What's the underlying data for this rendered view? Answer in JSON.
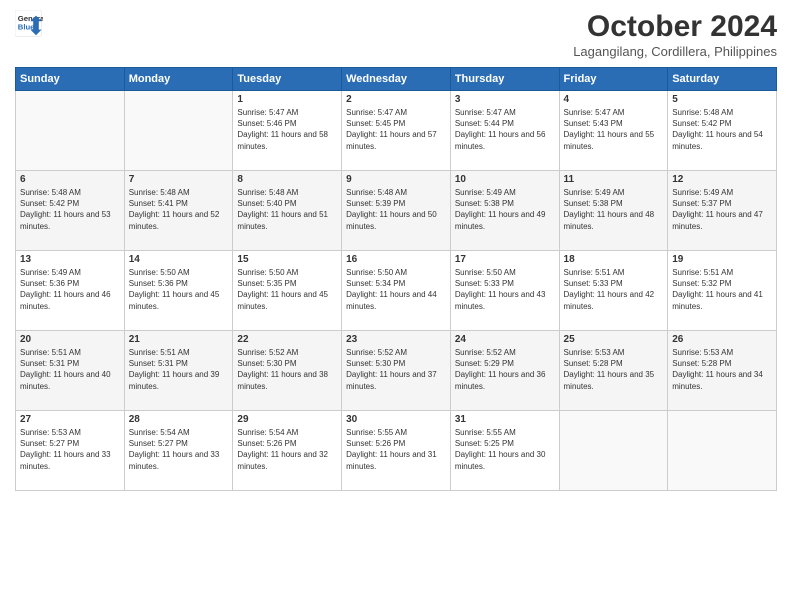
{
  "header": {
    "logo_line1": "General",
    "logo_line2": "Blue",
    "title": "October 2024",
    "subtitle": "Lagangilang, Cordillera, Philippines"
  },
  "days_of_week": [
    "Sunday",
    "Monday",
    "Tuesday",
    "Wednesday",
    "Thursday",
    "Friday",
    "Saturday"
  ],
  "weeks": [
    [
      {
        "day": "",
        "info": ""
      },
      {
        "day": "",
        "info": ""
      },
      {
        "day": "1",
        "info": "Sunrise: 5:47 AM\nSunset: 5:46 PM\nDaylight: 11 hours and 58 minutes."
      },
      {
        "day": "2",
        "info": "Sunrise: 5:47 AM\nSunset: 5:45 PM\nDaylight: 11 hours and 57 minutes."
      },
      {
        "day": "3",
        "info": "Sunrise: 5:47 AM\nSunset: 5:44 PM\nDaylight: 11 hours and 56 minutes."
      },
      {
        "day": "4",
        "info": "Sunrise: 5:47 AM\nSunset: 5:43 PM\nDaylight: 11 hours and 55 minutes."
      },
      {
        "day": "5",
        "info": "Sunrise: 5:48 AM\nSunset: 5:42 PM\nDaylight: 11 hours and 54 minutes."
      }
    ],
    [
      {
        "day": "6",
        "info": "Sunrise: 5:48 AM\nSunset: 5:42 PM\nDaylight: 11 hours and 53 minutes."
      },
      {
        "day": "7",
        "info": "Sunrise: 5:48 AM\nSunset: 5:41 PM\nDaylight: 11 hours and 52 minutes."
      },
      {
        "day": "8",
        "info": "Sunrise: 5:48 AM\nSunset: 5:40 PM\nDaylight: 11 hours and 51 minutes."
      },
      {
        "day": "9",
        "info": "Sunrise: 5:48 AM\nSunset: 5:39 PM\nDaylight: 11 hours and 50 minutes."
      },
      {
        "day": "10",
        "info": "Sunrise: 5:49 AM\nSunset: 5:38 PM\nDaylight: 11 hours and 49 minutes."
      },
      {
        "day": "11",
        "info": "Sunrise: 5:49 AM\nSunset: 5:38 PM\nDaylight: 11 hours and 48 minutes."
      },
      {
        "day": "12",
        "info": "Sunrise: 5:49 AM\nSunset: 5:37 PM\nDaylight: 11 hours and 47 minutes."
      }
    ],
    [
      {
        "day": "13",
        "info": "Sunrise: 5:49 AM\nSunset: 5:36 PM\nDaylight: 11 hours and 46 minutes."
      },
      {
        "day": "14",
        "info": "Sunrise: 5:50 AM\nSunset: 5:36 PM\nDaylight: 11 hours and 45 minutes."
      },
      {
        "day": "15",
        "info": "Sunrise: 5:50 AM\nSunset: 5:35 PM\nDaylight: 11 hours and 45 minutes."
      },
      {
        "day": "16",
        "info": "Sunrise: 5:50 AM\nSunset: 5:34 PM\nDaylight: 11 hours and 44 minutes."
      },
      {
        "day": "17",
        "info": "Sunrise: 5:50 AM\nSunset: 5:33 PM\nDaylight: 11 hours and 43 minutes."
      },
      {
        "day": "18",
        "info": "Sunrise: 5:51 AM\nSunset: 5:33 PM\nDaylight: 11 hours and 42 minutes."
      },
      {
        "day": "19",
        "info": "Sunrise: 5:51 AM\nSunset: 5:32 PM\nDaylight: 11 hours and 41 minutes."
      }
    ],
    [
      {
        "day": "20",
        "info": "Sunrise: 5:51 AM\nSunset: 5:31 PM\nDaylight: 11 hours and 40 minutes."
      },
      {
        "day": "21",
        "info": "Sunrise: 5:51 AM\nSunset: 5:31 PM\nDaylight: 11 hours and 39 minutes."
      },
      {
        "day": "22",
        "info": "Sunrise: 5:52 AM\nSunset: 5:30 PM\nDaylight: 11 hours and 38 minutes."
      },
      {
        "day": "23",
        "info": "Sunrise: 5:52 AM\nSunset: 5:30 PM\nDaylight: 11 hours and 37 minutes."
      },
      {
        "day": "24",
        "info": "Sunrise: 5:52 AM\nSunset: 5:29 PM\nDaylight: 11 hours and 36 minutes."
      },
      {
        "day": "25",
        "info": "Sunrise: 5:53 AM\nSunset: 5:28 PM\nDaylight: 11 hours and 35 minutes."
      },
      {
        "day": "26",
        "info": "Sunrise: 5:53 AM\nSunset: 5:28 PM\nDaylight: 11 hours and 34 minutes."
      }
    ],
    [
      {
        "day": "27",
        "info": "Sunrise: 5:53 AM\nSunset: 5:27 PM\nDaylight: 11 hours and 33 minutes."
      },
      {
        "day": "28",
        "info": "Sunrise: 5:54 AM\nSunset: 5:27 PM\nDaylight: 11 hours and 33 minutes."
      },
      {
        "day": "29",
        "info": "Sunrise: 5:54 AM\nSunset: 5:26 PM\nDaylight: 11 hours and 32 minutes."
      },
      {
        "day": "30",
        "info": "Sunrise: 5:55 AM\nSunset: 5:26 PM\nDaylight: 11 hours and 31 minutes."
      },
      {
        "day": "31",
        "info": "Sunrise: 5:55 AM\nSunset: 5:25 PM\nDaylight: 11 hours and 30 minutes."
      },
      {
        "day": "",
        "info": ""
      },
      {
        "day": "",
        "info": ""
      }
    ]
  ]
}
